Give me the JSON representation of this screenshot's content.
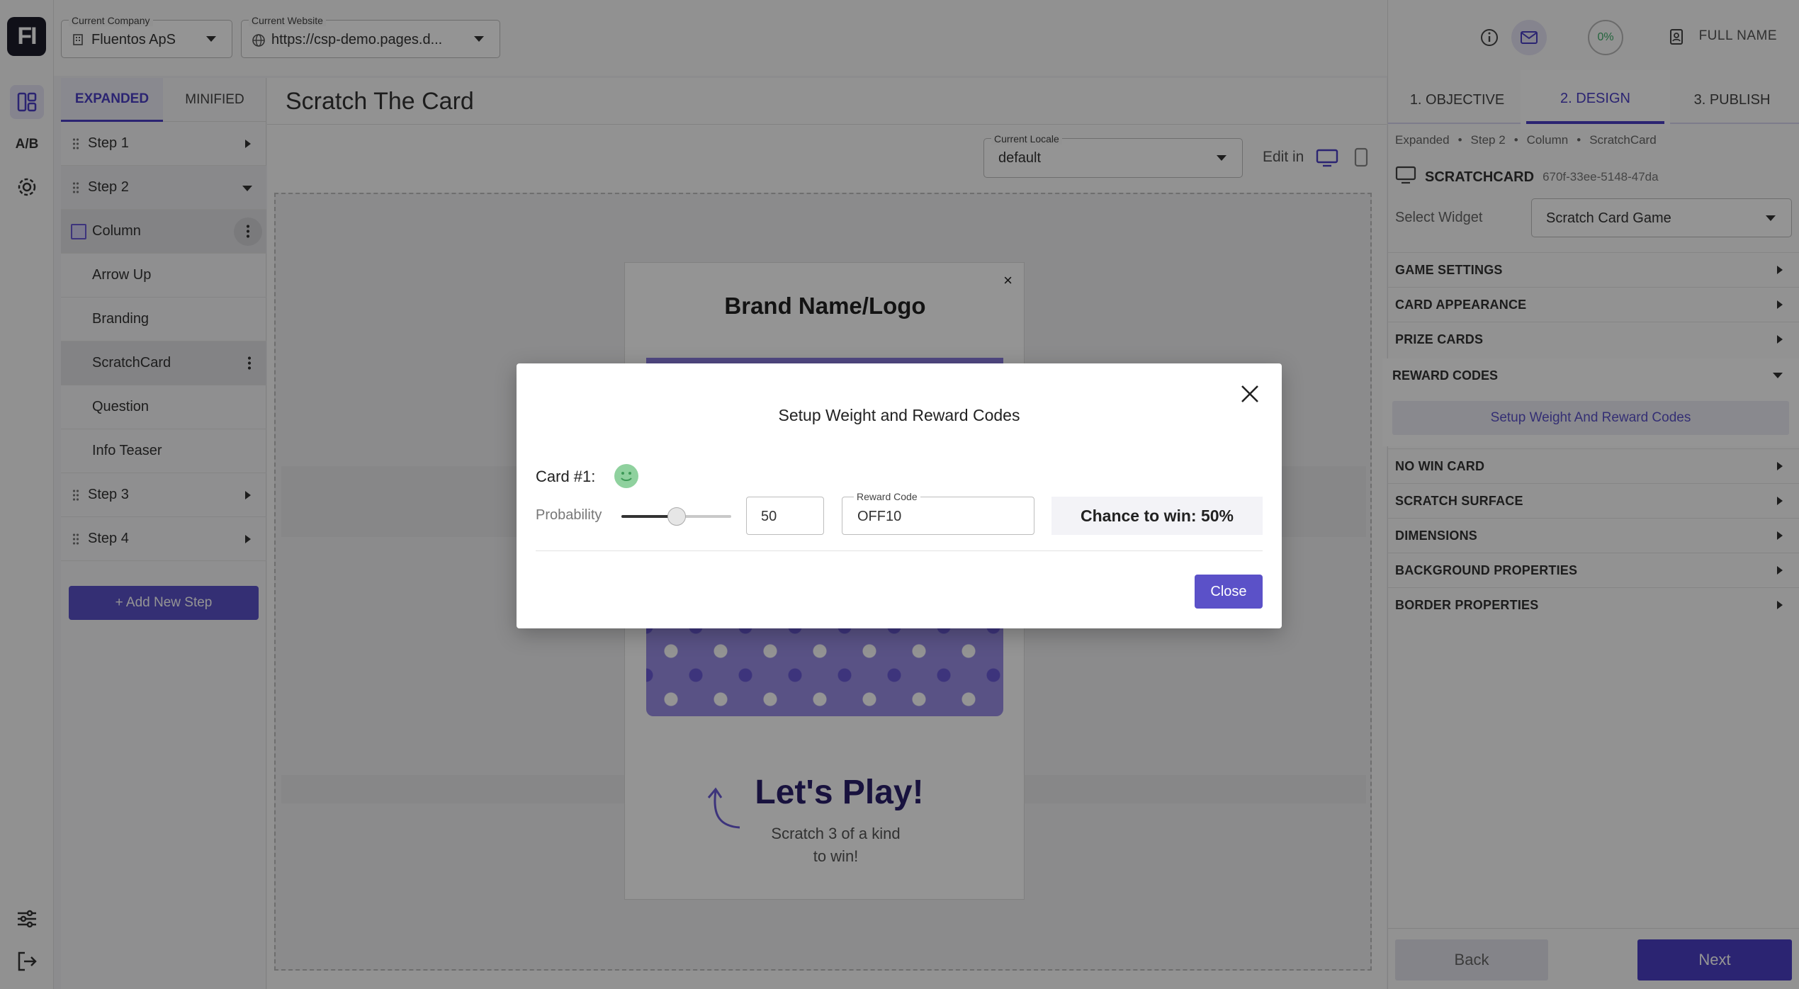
{
  "rail": {
    "logo": "FI",
    "ab_label": "A/B"
  },
  "topbar": {
    "company": {
      "label": "Current Company",
      "value": "Fluentos ApS"
    },
    "website": {
      "label": "Current Website",
      "value": "https://csp-demo.pages.d..."
    }
  },
  "steps": {
    "tabs": [
      "EXPANDED",
      "MINIFIED"
    ],
    "items": [
      "Step 1",
      "Step 2",
      "Column",
      "Arrow Up",
      "Branding",
      "ScratchCard",
      "Question",
      "Info Teaser",
      "Step 3",
      "Step 4"
    ],
    "add_label": "+ Add New Step"
  },
  "main": {
    "title": "Scratch The Card",
    "locale": {
      "label": "Current Locale",
      "value": "default"
    },
    "edit_in": "Edit in",
    "preview": {
      "brand": "Brand Name/Logo",
      "close": "×",
      "play": "Let's Play!",
      "sub1": "Scratch 3 of a kind",
      "sub2": "to win!"
    }
  },
  "right": {
    "progress": "0%",
    "user": "FULL NAME",
    "tabs": [
      "1. OBJECTIVE",
      "2. DESIGN",
      "3. PUBLISH"
    ],
    "breadcrumb": [
      "Expanded",
      "Step 2",
      "Column",
      "ScratchCard"
    ],
    "widget_name": "SCRATCHCARD",
    "widget_id": "670f-33ee-5148-47da",
    "select_label": "Select Widget",
    "select_value": "Scratch Card Game",
    "sections_before": [
      "GAME SETTINGS",
      "CARD APPEARANCE",
      "PRIZE CARDS"
    ],
    "reward": {
      "title": "REWARD CODES",
      "button": "Setup Weight And Reward Codes"
    },
    "sections_after": [
      "NO WIN CARD",
      "SCRATCH SURFACE",
      "DIMENSIONS",
      "BACKGROUND PROPERTIES",
      "BORDER PROPERTIES"
    ],
    "back": "Back",
    "next": "Next"
  },
  "dialog": {
    "title": "Setup Weight and Reward Codes",
    "card_label": "Card #1:",
    "probability_label": "Probability",
    "probability_value": "50",
    "probability_fraction": 0.5,
    "reward_code_label": "Reward Code",
    "reward_code_value": "OFF10",
    "chance": "Chance to win: 50%",
    "close_button": "Close"
  },
  "colors": {
    "accent": "#4b3fc4",
    "button": "#5b51c8",
    "preview_purple": "#9a8ee6"
  }
}
